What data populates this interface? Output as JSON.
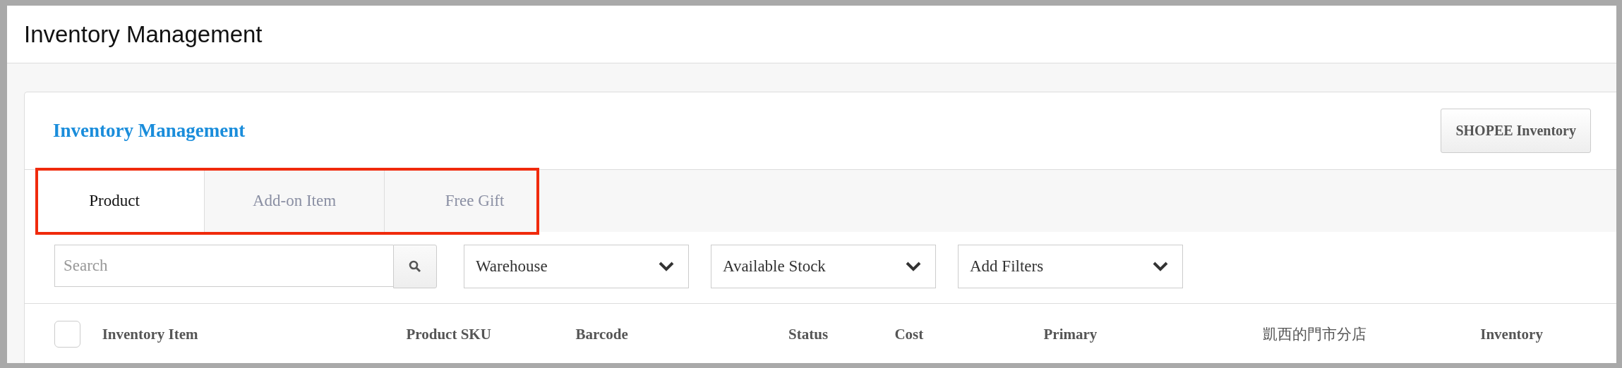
{
  "page_title": "Inventory Management",
  "card": {
    "title": "Inventory Management",
    "action_button": "SHOPEE Inventory"
  },
  "tabs": [
    {
      "label": "Product",
      "selected": true
    },
    {
      "label": "Add-on Item",
      "selected": false
    },
    {
      "label": "Free Gift",
      "selected": false
    }
  ],
  "tabs_highlighted": true,
  "search": {
    "placeholder": "Search"
  },
  "filters": [
    {
      "label": "Warehouse"
    },
    {
      "label": "Available Stock"
    },
    {
      "label": "Add Filters"
    }
  ],
  "table": {
    "select_all_checked": false,
    "columns": [
      "Inventory Item",
      "Product SKU",
      "Barcode",
      "Status",
      "Cost",
      "Primary",
      "凱西的門市分店",
      "Inventory"
    ]
  }
}
